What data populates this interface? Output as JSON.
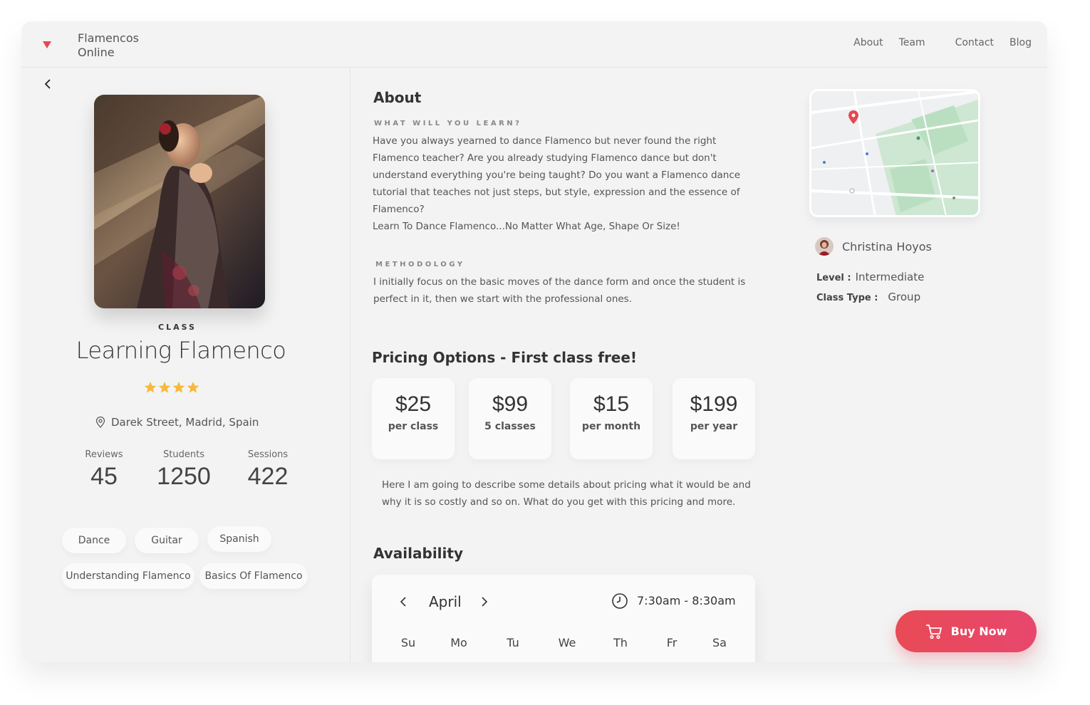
{
  "header": {
    "brand_line1": "Flamencos",
    "brand_line2": "Online",
    "nav": [
      "About",
      "Team",
      "Contact",
      "Blog"
    ]
  },
  "class_info": {
    "label": "CLASS",
    "title": "Learning Flamenco",
    "rating": 4,
    "location": "Darek Street, Madrid, Spain",
    "stats": [
      {
        "label": "Reviews",
        "value": "45"
      },
      {
        "label": "Students",
        "value": "1250"
      },
      {
        "label": "Sessions",
        "value": "422"
      }
    ],
    "tags": [
      "Dance",
      "Guitar",
      "Spanish",
      "Understanding Flamenco",
      "Basics Of Flamenco"
    ]
  },
  "about": {
    "heading": "About",
    "learn_label": "WHAT WILL YOU LEARN?",
    "learn_text_1": "Have you always yearned to dance Flamenco but never found the right Flamenco teacher? Are you already studying Flamenco dance but don't understand everything you're being taught? Do you want a Flamenco dance tutorial that teaches not just steps, but style, expression and the essence of Flamenco?",
    "learn_text_2": "Learn To Dance Flamenco...No Matter What Age, Shape Or Size!",
    "method_label": "METHODOLOGY",
    "method_text": "I initially focus on the basic moves of the dance form and once the student is perfect in it, then we start with the professional ones."
  },
  "pricing": {
    "heading": "Pricing Options - First class free!",
    "options": [
      {
        "amount": "$25",
        "period": "per class"
      },
      {
        "amount": "$99",
        "period": "5 classes"
      },
      {
        "amount": "$15",
        "period": "per month"
      },
      {
        "amount": "$199",
        "period": "per year"
      }
    ],
    "note": "Here I am going to describe some details about pricing what it would be and why it is so costly and so on. What do you get with this pricing and more."
  },
  "availability": {
    "heading": "Availability",
    "month": "April",
    "time": "7:30am - 8:30am",
    "days": [
      "Su",
      "Mo",
      "Tu",
      "We",
      "Th",
      "Fr",
      "Sa"
    ]
  },
  "teacher": {
    "name": "Christina Hoyos",
    "level_label": "Level :",
    "level": "Intermediate",
    "type_label": "Class Type :",
    "type": "Group"
  },
  "buy_label": "Buy Now",
  "colors": {
    "accent": "#e84a55",
    "star": "#f6b93b",
    "background": "#f3f3f3"
  }
}
